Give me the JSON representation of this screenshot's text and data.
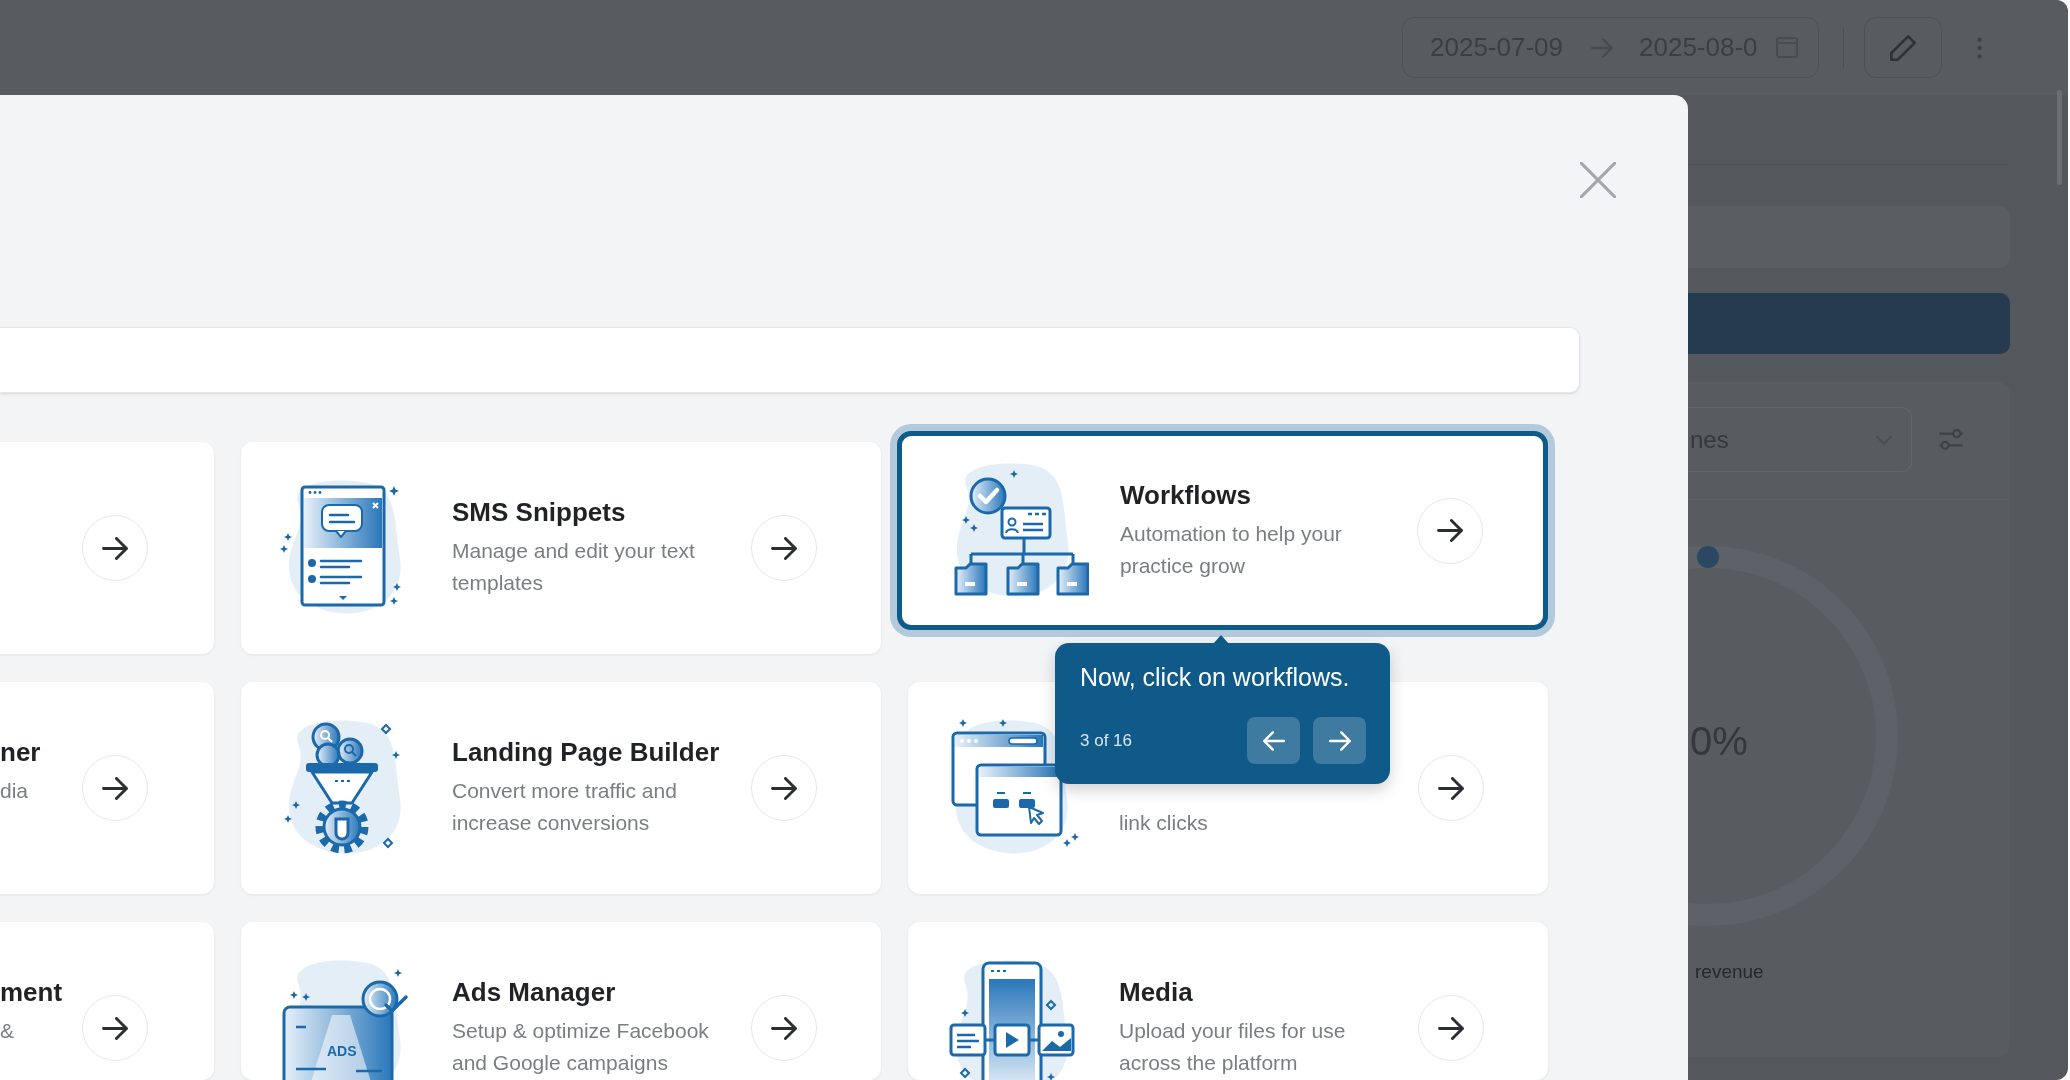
{
  "top_bar": {
    "date_range": {
      "start": "2025-07-09",
      "end": "2025-08-0"
    }
  },
  "background_page": {
    "select": {
      "value": "nes"
    },
    "progress": {
      "reading": "0%",
      "caption": "revenue"
    }
  },
  "modal": {
    "cards": [
      {
        "highlighted": false
      },
      {
        "title": "SMS Snippets",
        "description": "Manage and edit your text templates",
        "highlighted": false
      },
      {
        "title": "Workflows",
        "description": "Automation to help your practice grow",
        "highlighted": true
      },
      {
        "title": "ner",
        "description": "dia",
        "highlighted": false
      },
      {
        "title": "Landing Page Builder",
        "description": "Convert more traffic and increase conversions",
        "highlighted": false
      },
      {
        "description": "link clicks",
        "highlighted": false
      },
      {
        "title": "ment",
        "description": "&",
        "highlighted": false
      },
      {
        "title": "Ads Manager",
        "description": "Setup & optimize Facebook and Google campaigns",
        "icon_label": "ADS",
        "highlighted": false
      },
      {
        "title": "Media",
        "description": "Upload your files for use across the platform",
        "highlighted": false
      }
    ],
    "tour": {
      "message": "Now, click on workflows.",
      "step": "3 of 16"
    }
  }
}
